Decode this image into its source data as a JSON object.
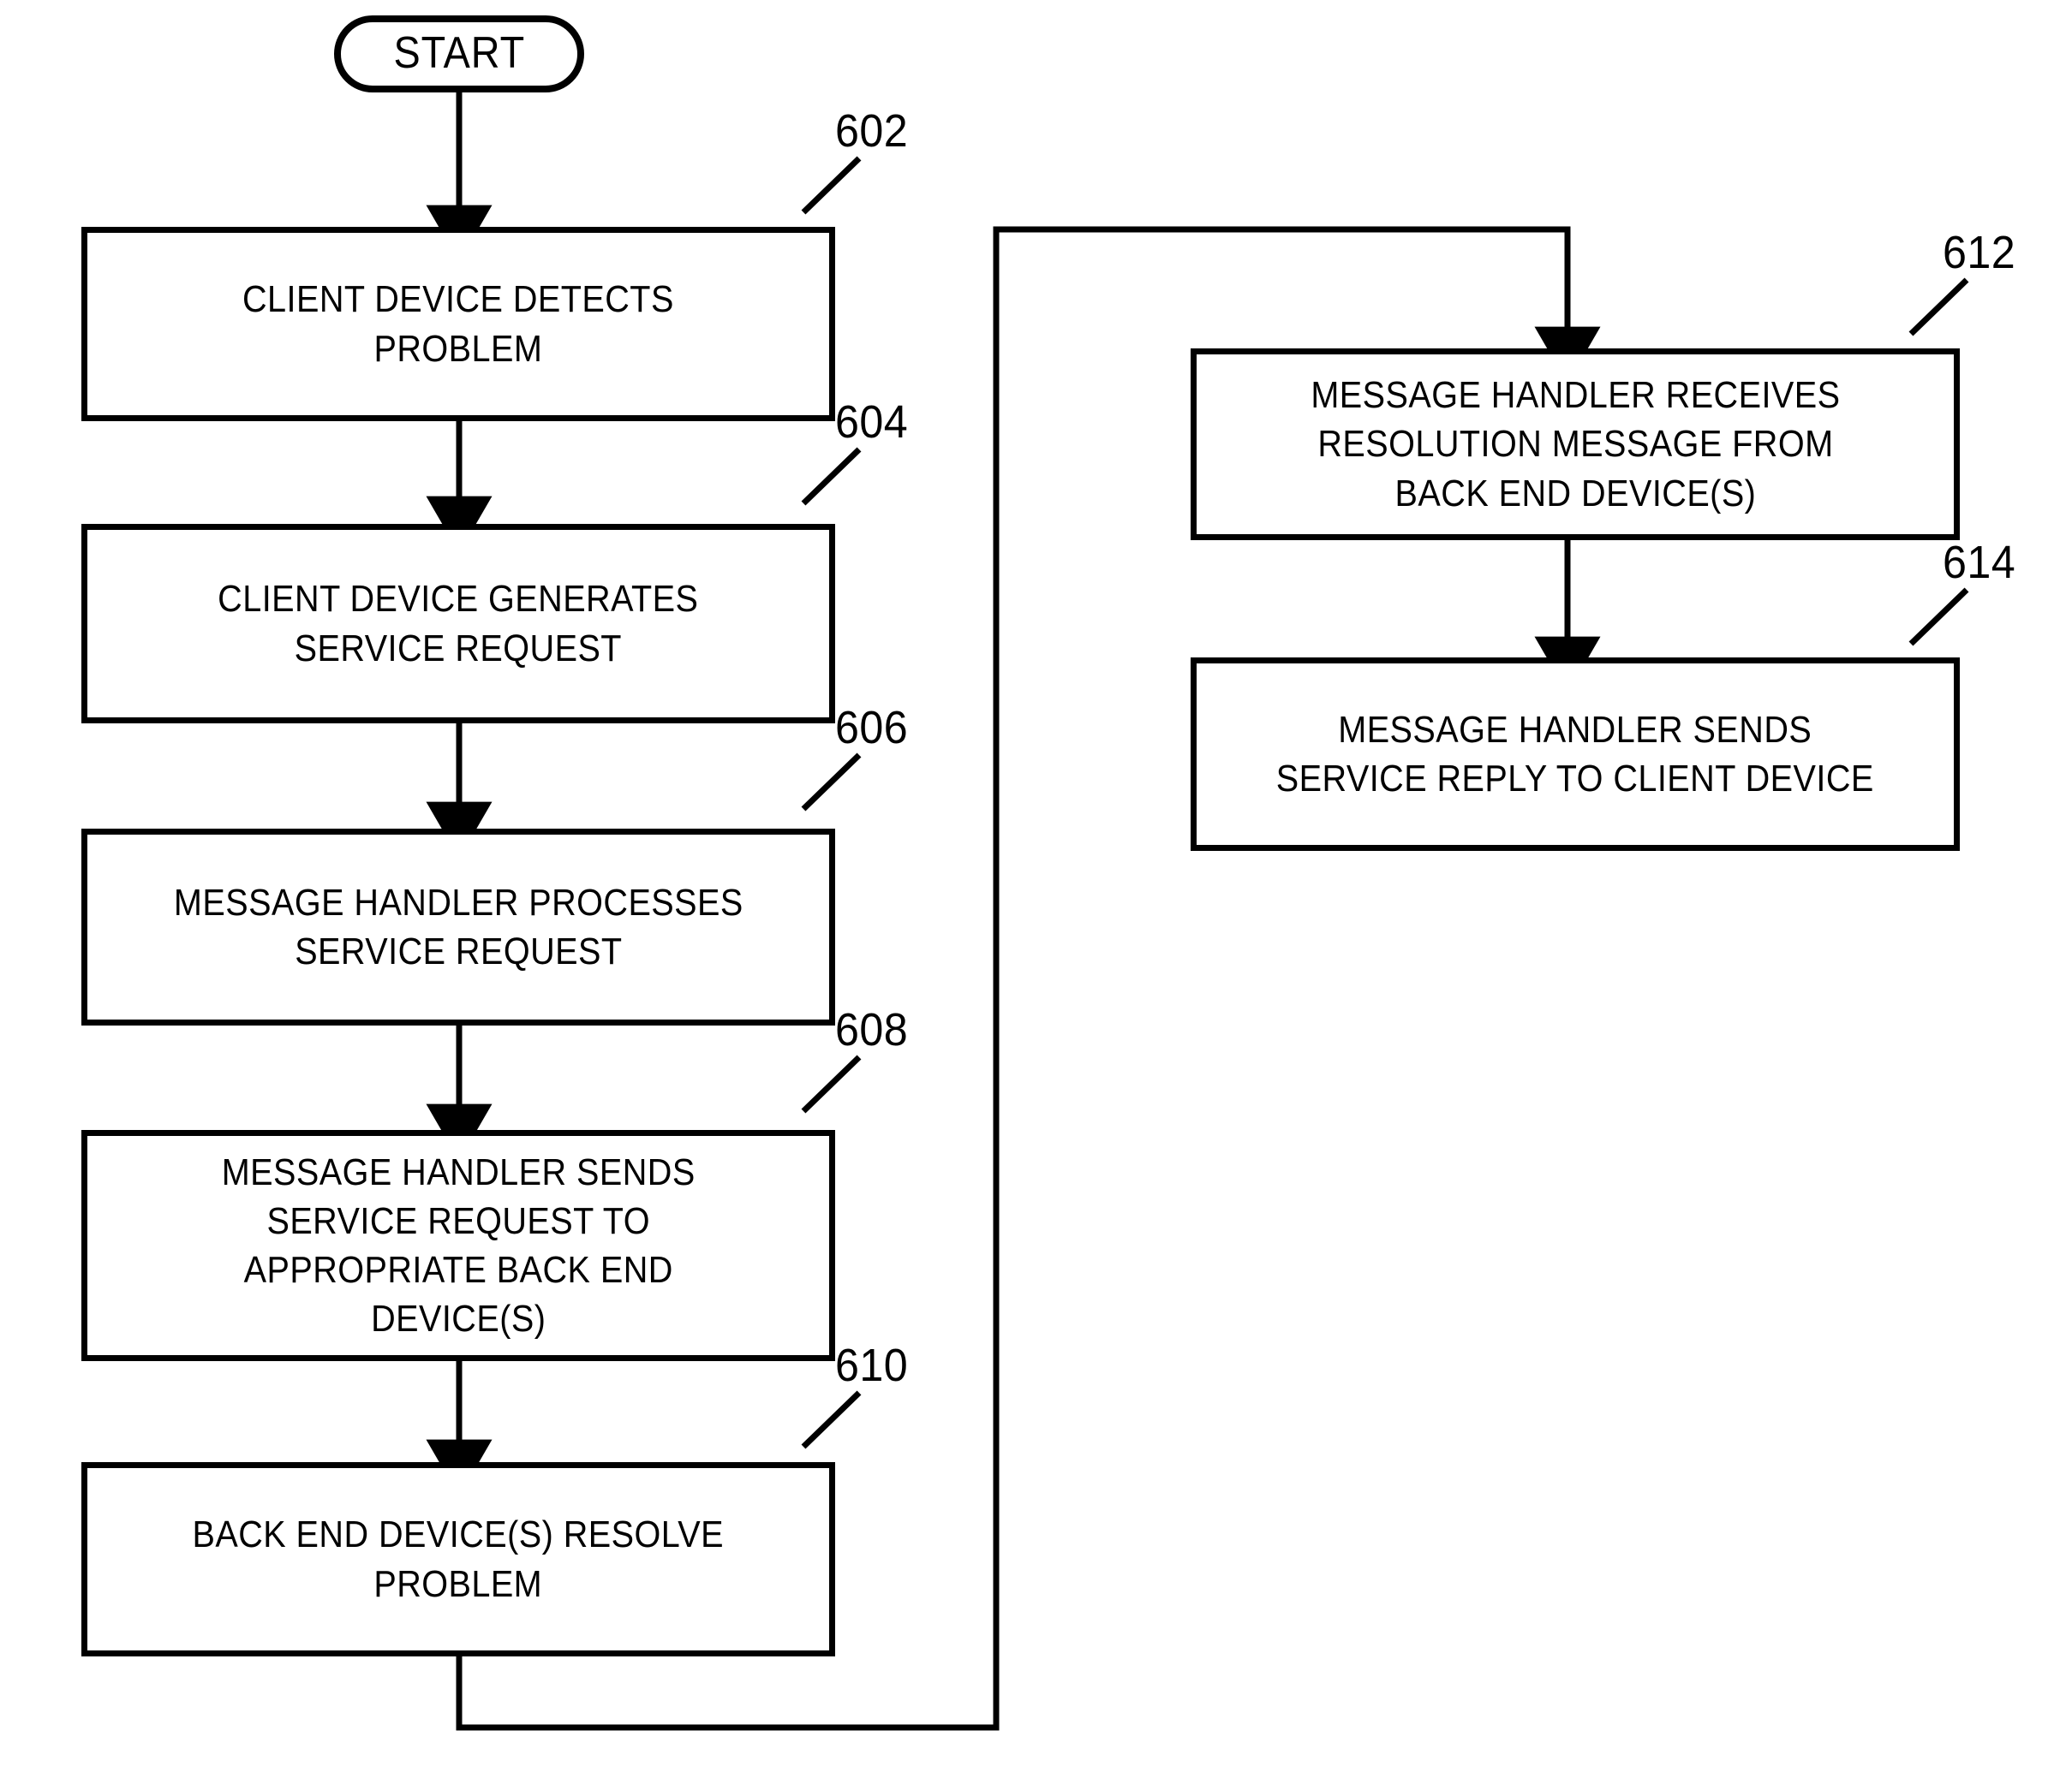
{
  "figure": {
    "type": "process-flowchart",
    "orientation": "two-column-with-feedback-loop",
    "background_color": "#ffffff",
    "line_color": "#000000",
    "text_color": "#000000"
  },
  "terminal": {
    "label": "START",
    "shape": "stadium"
  },
  "nodes": [
    {
      "ref": "602",
      "label": "CLIENT DEVICE DETECTS\nPROBLEM",
      "shape": "rectangle",
      "column": "left"
    },
    {
      "ref": "604",
      "label": "CLIENT DEVICE GENERATES\nSERVICE REQUEST",
      "shape": "rectangle",
      "column": "left"
    },
    {
      "ref": "606",
      "label": "MESSAGE HANDLER PROCESSES\nSERVICE REQUEST",
      "shape": "rectangle",
      "column": "left"
    },
    {
      "ref": "608",
      "label": "MESSAGE HANDLER SENDS\nSERVICE REQUEST TO\nAPPROPRIATE BACK END\nDEVICE(S)",
      "shape": "rectangle",
      "column": "left"
    },
    {
      "ref": "610",
      "label": "BACK END DEVICE(S) RESOLVE\nPROBLEM",
      "shape": "rectangle",
      "column": "left"
    },
    {
      "ref": "612",
      "label": "MESSAGE HANDLER RECEIVES\nRESOLUTION MESSAGE FROM\nBACK END DEVICE(S)",
      "shape": "rectangle",
      "column": "right"
    },
    {
      "ref": "614",
      "label": "MESSAGE HANDLER SENDS\nSERVICE REPLY TO CLIENT DEVICE",
      "shape": "rectangle",
      "column": "right"
    }
  ],
  "connectors": [
    {
      "from": "START",
      "to": "602",
      "style": "arrow-down"
    },
    {
      "from": "602",
      "to": "604",
      "style": "arrow-down"
    },
    {
      "from": "604",
      "to": "606",
      "style": "arrow-down"
    },
    {
      "from": "606",
      "to": "608",
      "style": "arrow-down"
    },
    {
      "from": "608",
      "to": "610",
      "style": "arrow-down"
    },
    {
      "from": "610",
      "to": "612",
      "style": "feedback-loop-down-right-up-right-down-arrow"
    },
    {
      "from": "612",
      "to": "614",
      "style": "arrow-down"
    }
  ]
}
